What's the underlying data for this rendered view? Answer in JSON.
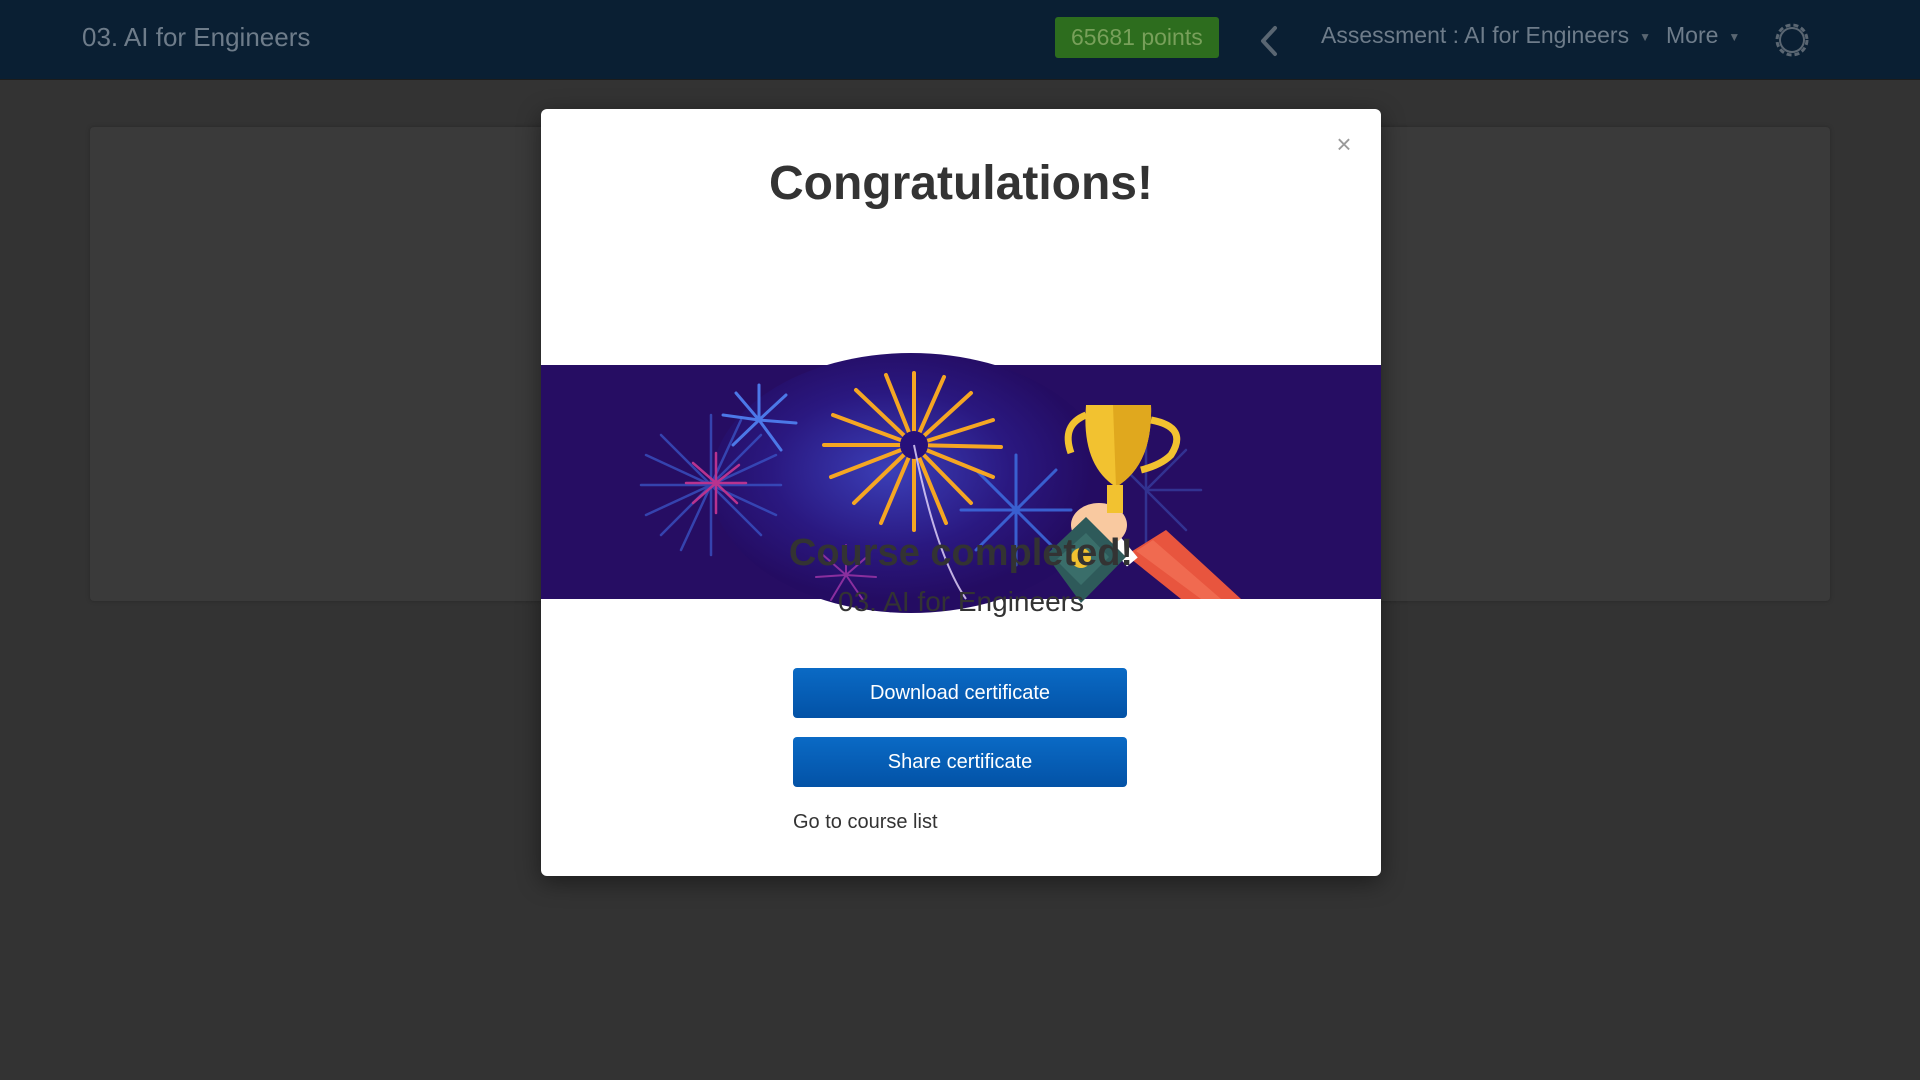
{
  "topbar": {
    "course_title": "03. AI for Engineers",
    "points_label": "65681 points",
    "back_icon": "chevron-left-icon",
    "assessment_dropdown": "Assessment : AI for Engineers",
    "more_dropdown": "More",
    "settings_icon": "gear-icon"
  },
  "modal": {
    "title": "Congratulations!",
    "close_label": "×",
    "banner_image": "fireworks-trophy-illustration",
    "subtitle": "Course completed!",
    "course_name": "03. AI for Engineers",
    "download_button": "Download certificate",
    "share_button": "Share certificate",
    "goto_link": "Go to course list"
  },
  "colors": {
    "topbar_bg": "#0a1f33",
    "overlay_bg": "#333333",
    "points_badge": "#2d6d1e",
    "button_blue": "#0a5fb8",
    "banner_bg": "#2a0e6b",
    "firework_orange": "#f5a623",
    "trophy_gold": "#f2c230",
    "sleeve_red": "#e8553e"
  }
}
